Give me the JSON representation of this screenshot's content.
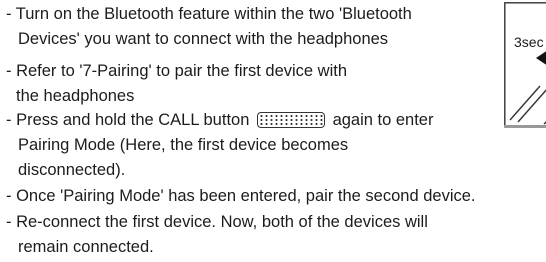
{
  "instructions": {
    "items": [
      {
        "lines": [
          "- Turn on the Bluetooth feature within the two 'Bluetooth",
          "Devices' you want to connect with the headphones"
        ]
      },
      {
        "lines": [
          "- Refer to '7-Pairing' to pair the first device with",
          "the headphones"
        ]
      },
      {
        "line1_before": "- Press and hold the CALL button",
        "line1_after": "again to enter",
        "lines": [
          "Pairing Mode (Here, the first device becomes",
          "disconnected)."
        ]
      },
      {
        "lines": [
          "- Once 'Pairing Mode' has been entered, pair the second device."
        ]
      },
      {
        "lines": [
          "- Re-connect the first device. Now, both of the devices will",
          "remain connected."
        ]
      }
    ]
  },
  "figure": {
    "label": "3sec",
    "icons": [
      "call-button-icon",
      "press-arrow-icon"
    ]
  }
}
